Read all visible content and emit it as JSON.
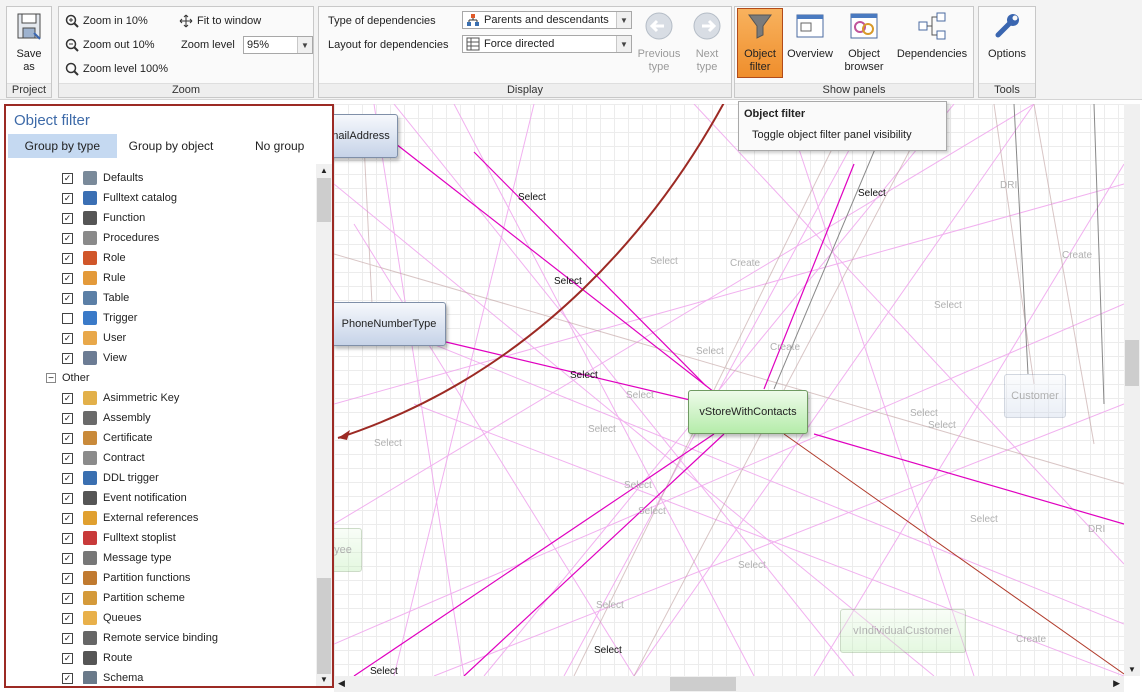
{
  "ribbon": {
    "project": {
      "caption": "Project",
      "save": "Save as"
    },
    "zoom": {
      "caption": "Zoom",
      "zoom_in": "Zoom in 10%",
      "zoom_out": "Zoom out 10%",
      "zoom_100": "Zoom level 100%",
      "fit": "Fit to window",
      "level_label": "Zoom level",
      "level_value": "95%"
    },
    "display": {
      "caption": "Display",
      "type_label": "Type of dependencies",
      "type_value": "Parents and descendants",
      "layout_label": "Layout for dependencies",
      "layout_value": "Force directed",
      "prev": "Previous type",
      "next": "Next type"
    },
    "panels": {
      "caption": "Show panels",
      "object_filter": "Object filter",
      "overview": "Overview",
      "object_browser": "Object browser",
      "dependencies": "Dependencies"
    },
    "tools": {
      "caption": "Tools",
      "options": "Options"
    }
  },
  "tooltip": {
    "title": "Object filter",
    "text": "Toggle object filter panel visibility"
  },
  "filter_panel": {
    "title": "Object filter",
    "tabs": [
      "Group by type",
      "Group by object",
      "No group"
    ],
    "items": [
      {
        "label": "Defaults",
        "checked": true,
        "color": "#7a8a9a"
      },
      {
        "label": "Fulltext catalog",
        "checked": true,
        "color": "#3b6fb3"
      },
      {
        "label": "Function",
        "checked": true,
        "color": "#555555"
      },
      {
        "label": "Procedures",
        "checked": true,
        "color": "#8a8a8a"
      },
      {
        "label": "Role",
        "checked": true,
        "color": "#d0562a"
      },
      {
        "label": "Rule",
        "checked": true,
        "color": "#e39a3a"
      },
      {
        "label": "Table",
        "checked": true,
        "color": "#5b7fa6"
      },
      {
        "label": "Trigger",
        "checked": false,
        "color": "#3a7ac8"
      },
      {
        "label": "User",
        "checked": true,
        "color": "#e8a84a"
      },
      {
        "label": "View",
        "checked": true,
        "color": "#6c7c94"
      }
    ],
    "group_other": "Other",
    "other_items": [
      {
        "label": "Asimmetric Key",
        "checked": true,
        "color": "#e2b04a"
      },
      {
        "label": "Assembly",
        "checked": true,
        "color": "#6a6a6a"
      },
      {
        "label": "Certificate",
        "checked": true,
        "color": "#c98a3a"
      },
      {
        "label": "Contract",
        "checked": true,
        "color": "#8b8b8b"
      },
      {
        "label": "DDL trigger",
        "checked": true,
        "color": "#3a6fb0"
      },
      {
        "label": "Event notification",
        "checked": true,
        "color": "#555555"
      },
      {
        "label": "External references",
        "checked": true,
        "color": "#e0a030"
      },
      {
        "label": "Fulltext stoplist",
        "checked": true,
        "color": "#c83a3a"
      },
      {
        "label": "Message type",
        "checked": true,
        "color": "#777777"
      },
      {
        "label": "Partition functions",
        "checked": true,
        "color": "#c07a30"
      },
      {
        "label": "Partition scheme",
        "checked": true,
        "color": "#d49a3a"
      },
      {
        "label": "Queues",
        "checked": true,
        "color": "#e8b04a"
      },
      {
        "label": "Remote service binding",
        "checked": true,
        "color": "#666666"
      },
      {
        "label": "Route",
        "checked": true,
        "color": "#555555"
      },
      {
        "label": "Schema",
        "checked": true,
        "color": "#6a7a8a"
      }
    ]
  },
  "diagram": {
    "nodes": {
      "email": "nailAddress",
      "phone": "PhoneNumberType",
      "vstore": "vStoreWithContacts",
      "customer": "Customer",
      "vindividual": "vIndividualCustomer",
      "employee": "yee"
    },
    "edge_label": "Select",
    "faint_labels": [
      "Select",
      "Create",
      "DRI"
    ]
  },
  "colors": {
    "accent_red": "#9c2a24",
    "select_orange": "#ef8e2c",
    "tab_blue": "#c5d9f1",
    "title_blue": "#3d6aa8",
    "edge_magenta": "#e000c0"
  }
}
